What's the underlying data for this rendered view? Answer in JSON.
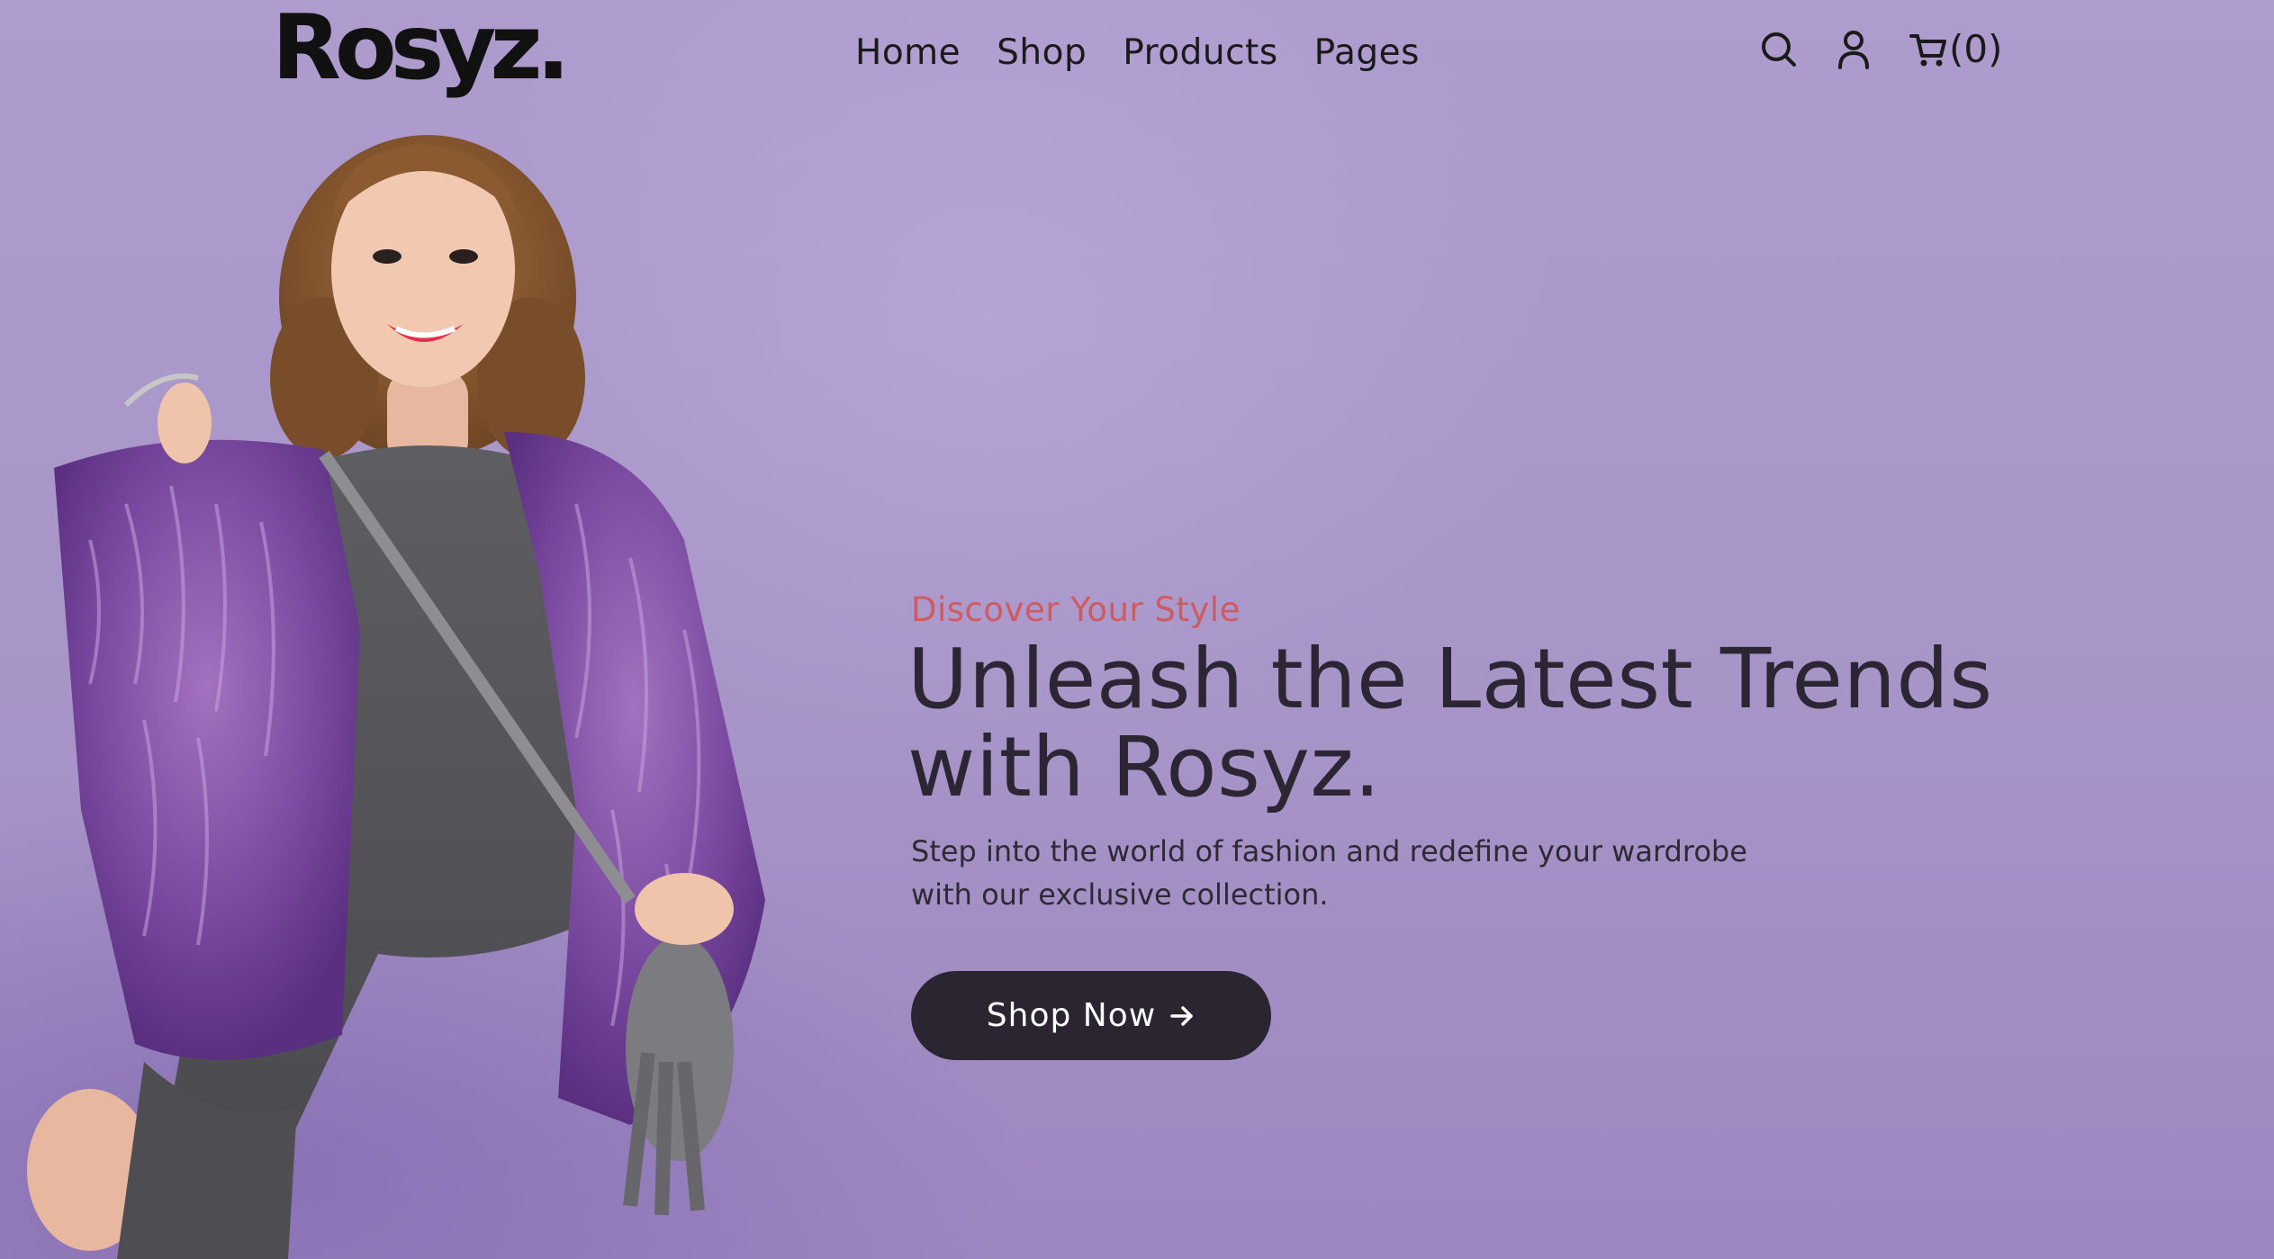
{
  "brand": {
    "logo_text": "Rosyz."
  },
  "nav": {
    "items": [
      {
        "label": "Home"
      },
      {
        "label": "Shop"
      },
      {
        "label": "Products"
      },
      {
        "label": "Pages"
      }
    ]
  },
  "header_actions": {
    "search_icon": "search-icon",
    "account_icon": "user-icon",
    "cart_icon": "cart-icon",
    "cart_count": "(0)"
  },
  "hero": {
    "eyebrow": "Discover Your Style",
    "headline_line1": "Unleash the Latest Trends",
    "headline_line2": "with Rosyz.",
    "subtext_line1": "Step into the world of fashion and redefine your wardrobe",
    "subtext_line2": "with our exclusive collection.",
    "cta_label": "Shop Now",
    "cta_icon": "arrow-right-icon"
  },
  "colors": {
    "background": "#a996c9",
    "eyebrow": "#cf5a5f",
    "headline": "#2c2634",
    "button": "#2b2532",
    "button_text": "#ffffff"
  }
}
